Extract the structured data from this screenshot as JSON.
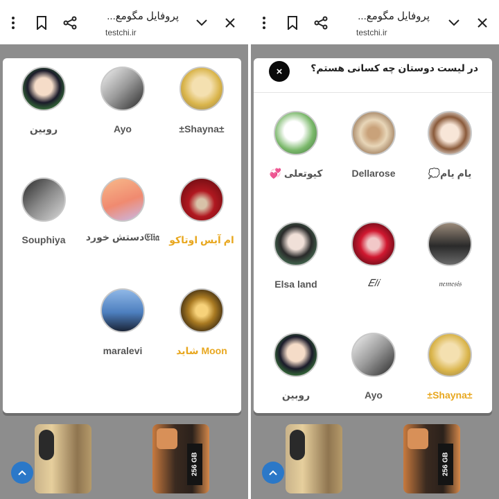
{
  "left_panel": {
    "browser": {
      "title": "پروفایل مگومع...",
      "url": "testchi.ir"
    },
    "friends": [
      {
        "name": "±Shayna±",
        "highlight": false,
        "avatar": "anime-girl-blonde"
      },
      {
        "name": "Ayo",
        "highlight": false,
        "avatar": "bw-photo"
      },
      {
        "name": "روبین",
        "highlight": false,
        "avatar": "anime-girl-dark"
      },
      {
        "name": "ام آیس اوتاکو",
        "highlight": true,
        "avatar": "red-scene"
      },
      {
        "name": "𝔈𝔩𝔦𝔞دستش خورد",
        "highlight": false,
        "avatar": "girl-orange"
      },
      {
        "name": "Souphiya",
        "highlight": false,
        "avatar": "bw-person"
      },
      {
        "name": "شاید Moon",
        "highlight": true,
        "avatar": "gold-moon"
      },
      {
        "name": "maralevi",
        "highlight": false,
        "avatar": "cat-window"
      }
    ]
  },
  "right_panel": {
    "browser": {
      "title": "پروفایل مگومع...",
      "url": "testchi.ir"
    },
    "modal_title": "در لیست دوستان چه کسانی هستم؟",
    "close_label": "×",
    "friends": [
      {
        "name": "یام یام💭",
        "highlight": false,
        "avatar": "anime-brown-hair"
      },
      {
        "name": "Dellarose",
        "highlight": false,
        "avatar": "teacup"
      },
      {
        "name": "کیوتعلی 💞",
        "highlight": false,
        "avatar": "anime-green"
      },
      {
        "name": "𝔫𝔢𝔪𝔢𝔰𝔦𝔰",
        "highlight": false,
        "avatar": "boy-black"
      },
      {
        "name": "𝐸𝑙𝑖",
        "highlight": false,
        "avatar": "red-anime"
      },
      {
        "name": "Elsa land",
        "highlight": false,
        "avatar": "green-anime"
      },
      {
        "name": "±Shayna±",
        "highlight": true,
        "avatar": "anime-girl-blonde"
      },
      {
        "name": "Ayo",
        "highlight": false,
        "avatar": "bw-photo"
      },
      {
        "name": "روبین",
        "highlight": false,
        "avatar": "anime-girl-dark"
      }
    ]
  },
  "product_label": "256 GB",
  "colors": {
    "highlight": "#e8a71f",
    "scroll_button": "#2b78c8",
    "backdrop": "#8d8d8d"
  }
}
